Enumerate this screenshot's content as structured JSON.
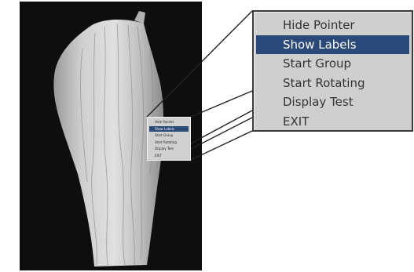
{
  "scene": {
    "background_color": "#0e0e0e",
    "model_color": "#c8c8c8"
  },
  "context_menu": {
    "selected_index": 1,
    "selected_color": "#2b4a79",
    "items": [
      {
        "label": "Hide Pointer"
      },
      {
        "label": "Show Labels"
      },
      {
        "label": "Start Group"
      },
      {
        "label": "Start Rotating"
      },
      {
        "label": "Display Test"
      },
      {
        "label": "EXIT"
      }
    ]
  }
}
